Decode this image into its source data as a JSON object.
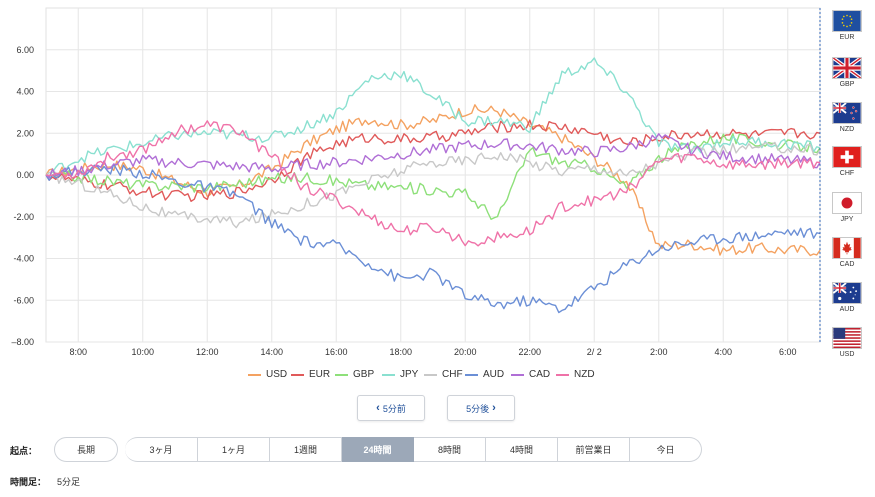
{
  "chart_data": {
    "type": "line",
    "xlabel": "",
    "ylabel": "",
    "ylim": [
      -8,
      8
    ],
    "yticks": [
      6,
      4,
      2,
      0,
      -2,
      -4,
      -6,
      -8
    ],
    "ytick_labels": [
      "6.00",
      "4.00",
      "2.00",
      "0.00",
      "-2.00",
      "-4.00",
      "-6.00",
      "–8.00"
    ],
    "xlim": [
      7.0,
      31.0
    ],
    "xticks": [
      8,
      10,
      12,
      14,
      16,
      18,
      20,
      22,
      24,
      26,
      28,
      30
    ],
    "xtick_labels": [
      "8:00",
      "10:00",
      "12:00",
      "14:00",
      "16:00",
      "18:00",
      "20:00",
      "22:00",
      "2/ 2",
      "2:00",
      "4:00",
      "6:00"
    ],
    "grid": true,
    "legend_position": "bottom",
    "series": [
      {
        "name": "USD",
        "color": "#f4a261",
        "x": [
          7,
          8,
          9,
          10,
          11,
          12,
          13,
          14,
          15,
          16,
          17,
          18,
          19,
          20,
          21,
          22,
          23,
          24,
          25,
          26,
          27,
          28,
          29,
          30,
          31
        ],
        "values": [
          0.0,
          0.3,
          0.5,
          0.3,
          -0.3,
          -0.8,
          -0.5,
          0.3,
          1.4,
          2.2,
          2.7,
          2.4,
          2.6,
          3.1,
          3.1,
          2.4,
          1.8,
          0.8,
          -0.3,
          -3.4,
          -3.3,
          -3.6,
          -3.5,
          -3.6,
          -3.6
        ]
      },
      {
        "name": "EUR",
        "color": "#e05a5a",
        "x": [
          7,
          8,
          9,
          10,
          11,
          12,
          13,
          14,
          15,
          16,
          17,
          18,
          19,
          20,
          21,
          22,
          23,
          24,
          25,
          26,
          27,
          28,
          29,
          30,
          31
        ],
        "values": [
          0.0,
          -0.3,
          -0.5,
          -0.8,
          -1.0,
          -1.0,
          -0.8,
          -0.2,
          0.8,
          1.5,
          1.8,
          1.7,
          1.8,
          2.0,
          2.3,
          2.4,
          2.3,
          2.0,
          1.5,
          1.8,
          2.0,
          2.0,
          1.9,
          2.0,
          2.0
        ]
      },
      {
        "name": "GBP",
        "color": "#8ee07a",
        "x": [
          7,
          8,
          9,
          10,
          11,
          12,
          13,
          14,
          15,
          16,
          17,
          18,
          19,
          20,
          21,
          22,
          23,
          24,
          25,
          26,
          27,
          28,
          29,
          30,
          31
        ],
        "values": [
          0.0,
          -0.1,
          -0.3,
          -0.5,
          -0.5,
          -0.6,
          -0.4,
          -0.2,
          -0.1,
          -0.3,
          -0.5,
          -0.6,
          -0.7,
          -0.9,
          -2.1,
          1.2,
          0.6,
          0.4,
          -0.6,
          0.8,
          1.5,
          1.8,
          1.6,
          1.4,
          1.3
        ]
      },
      {
        "name": "JPY",
        "color": "#8ae0d0",
        "x": [
          7,
          8,
          9,
          10,
          11,
          12,
          13,
          14,
          15,
          16,
          17,
          18,
          19,
          20,
          21,
          22,
          23,
          24,
          25,
          26,
          27,
          28,
          29,
          30,
          31
        ],
        "values": [
          0.0,
          0.8,
          1.2,
          1.5,
          1.9,
          2.0,
          1.9,
          1.8,
          2.3,
          3.0,
          4.6,
          4.9,
          3.8,
          2.6,
          2.6,
          2.3,
          4.8,
          5.4,
          4.0,
          1.5,
          1.2,
          1.6,
          1.6,
          1.5,
          1.3
        ]
      },
      {
        "name": "CHF",
        "color": "#c8c8c8",
        "x": [
          7,
          8,
          9,
          10,
          11,
          12,
          13,
          14,
          15,
          16,
          17,
          18,
          19,
          20,
          21,
          22,
          23,
          24,
          25,
          26,
          27,
          28,
          29,
          30,
          31
        ],
        "values": [
          0.0,
          -0.4,
          -0.9,
          -1.5,
          -2.0,
          -2.1,
          -2.3,
          -1.9,
          -1.4,
          -0.9,
          -0.3,
          0.2,
          0.6,
          0.7,
          1.0,
          0.6,
          0.2,
          0.4,
          0.0,
          0.6,
          1.0,
          1.2,
          1.3,
          1.3,
          1.2
        ]
      },
      {
        "name": "AUD",
        "color": "#6b8fd6",
        "x": [
          7,
          8,
          9,
          10,
          11,
          12,
          13,
          14,
          15,
          16,
          17,
          18,
          19,
          20,
          21,
          22,
          23,
          24,
          25,
          26,
          27,
          28,
          29,
          30,
          31
        ],
        "values": [
          0.0,
          0.2,
          0.3,
          0.1,
          -0.3,
          -0.6,
          -1.0,
          -2.3,
          -3.2,
          -3.4,
          -4.2,
          -5.0,
          -4.7,
          -5.8,
          -6.2,
          -6.0,
          -6.4,
          -5.4,
          -4.3,
          -3.5,
          -3.2,
          -3.0,
          -2.9,
          -2.7,
          -2.8
        ]
      },
      {
        "name": "CAD",
        "color": "#b06fd6",
        "x": [
          7,
          8,
          9,
          10,
          11,
          12,
          13,
          14,
          15,
          16,
          17,
          18,
          19,
          20,
          21,
          22,
          23,
          24,
          25,
          26,
          27,
          28,
          29,
          30,
          31
        ],
        "values": [
          0.0,
          0.2,
          0.5,
          0.7,
          0.6,
          0.5,
          0.4,
          0.3,
          0.5,
          0.6,
          0.8,
          1.0,
          1.2,
          1.4,
          1.5,
          1.4,
          1.2,
          1.1,
          1.3,
          1.8,
          1.2,
          0.9,
          0.8,
          0.7,
          0.6
        ]
      },
      {
        "name": "NZD",
        "color": "#ef72a8",
        "x": [
          7,
          8,
          9,
          10,
          11,
          12,
          13,
          14,
          15,
          16,
          17,
          18,
          19,
          20,
          21,
          22,
          23,
          24,
          25,
          26,
          27,
          28,
          29,
          30,
          31
        ],
        "values": [
          0.0,
          0.1,
          0.9,
          1.2,
          2.1,
          2.4,
          2.1,
          0.9,
          -0.6,
          -1.2,
          -2.0,
          -2.7,
          -2.5,
          -3.2,
          -3.0,
          -2.7,
          -1.5,
          -1.2,
          -0.8,
          0.7,
          0.9,
          0.5,
          0.5,
          0.6,
          0.6
        ]
      }
    ]
  },
  "flags": [
    {
      "code": "EUR",
      "icon": "eu-flag-icon"
    },
    {
      "code": "GBP",
      "icon": "uk-flag-icon"
    },
    {
      "code": "NZD",
      "icon": "nz-flag-icon"
    },
    {
      "code": "CHF",
      "icon": "swiss-flag-icon"
    },
    {
      "code": "JPY",
      "icon": "japan-flag-icon"
    },
    {
      "code": "CAD",
      "icon": "canada-flag-icon"
    },
    {
      "code": "AUD",
      "icon": "australia-flag-icon"
    },
    {
      "code": "USD",
      "icon": "us-flag-icon"
    }
  ],
  "nav": {
    "prev_label": "5分前",
    "next_label": "5分後",
    "prev_icon": "chevron-left-icon",
    "next_icon": "chevron-right-icon"
  },
  "start": {
    "label": "起点：",
    "long_term": "長期",
    "options": [
      "3ヶ月",
      "1ヶ月",
      "1週間",
      "24時間",
      "8時間",
      "4時間",
      "前営業日",
      "今日"
    ],
    "selected": "24時間"
  },
  "interval": {
    "label": "時間足：",
    "value": "5分足"
  },
  "colors": {
    "active_segment": "#9ca8b8",
    "nav_text": "#1f4f99",
    "dashed_divider": "#2f63b5"
  }
}
